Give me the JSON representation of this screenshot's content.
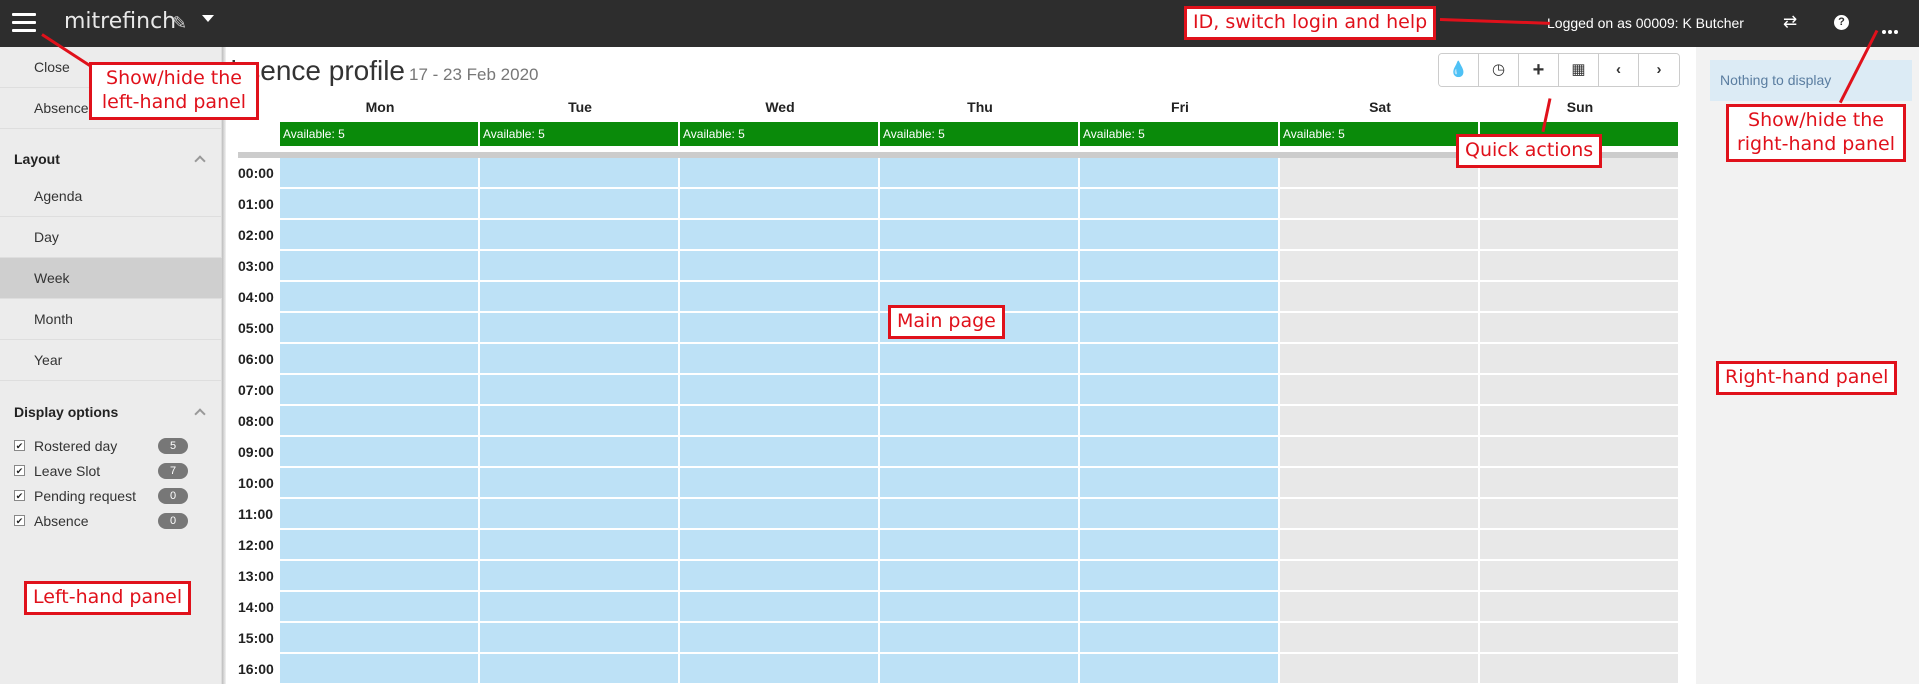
{
  "topbar": {
    "brand": "mitrefinch",
    "logged_on": "Logged on as 00009: K Butcher",
    "icons": [
      "menu-icon",
      "feather-icon",
      "chevron-down-icon",
      "switch-login-icon",
      "help-icon",
      "more-icon"
    ]
  },
  "left_panel": {
    "top_items": [
      {
        "label": "Close"
      },
      {
        "label": "Absence"
      }
    ],
    "layout": {
      "heading": "Layout",
      "items": [
        {
          "label": "Agenda",
          "active": false
        },
        {
          "label": "Day",
          "active": false
        },
        {
          "label": "Week",
          "active": true
        },
        {
          "label": "Month",
          "active": false
        },
        {
          "label": "Year",
          "active": false
        }
      ]
    },
    "display_options": {
      "heading": "Display options",
      "items": [
        {
          "label": "Rostered day",
          "checked": true,
          "count": "5"
        },
        {
          "label": "Leave Slot",
          "checked": true,
          "count": "7"
        },
        {
          "label": "Pending request",
          "checked": true,
          "count": "0"
        },
        {
          "label": "Absence",
          "checked": true,
          "count": "0"
        }
      ]
    }
  },
  "main": {
    "title": "Absence profile",
    "date_range": "17 - 23 Feb 2020",
    "quick_actions": [
      "drop-icon",
      "clock-icon",
      "plus-icon",
      "calendar-icon",
      "chevron-left-icon",
      "chevron-right-icon"
    ],
    "days": [
      {
        "name": "Mon",
        "available": "Available: 5",
        "type": "work"
      },
      {
        "name": "Tue",
        "available": "Available: 5",
        "type": "work"
      },
      {
        "name": "Wed",
        "available": "Available: 5",
        "type": "work"
      },
      {
        "name": "Thu",
        "available": "Available: 5",
        "type": "work"
      },
      {
        "name": "Fri",
        "available": "Available: 5",
        "type": "work"
      },
      {
        "name": "Sat",
        "available": "Available: 5",
        "type": "weekend"
      },
      {
        "name": "Sun",
        "available": "",
        "type": "weekend"
      }
    ],
    "hours": [
      "00:00",
      "01:00",
      "02:00",
      "03:00",
      "04:00",
      "05:00",
      "06:00",
      "07:00",
      "08:00",
      "09:00",
      "10:00",
      "11:00",
      "12:00",
      "13:00",
      "14:00",
      "15:00",
      "16:00"
    ],
    "colors": {
      "available": "#0a8a0a",
      "workday": "#bde1f6",
      "weekend": "#e8e8e8"
    }
  },
  "right_panel": {
    "empty_text": "Nothing to display"
  },
  "annotations": {
    "left_toggle": "Show/hide the left-hand panel",
    "id_help": "ID, switch login and help",
    "right_toggle": "Show/hide the right-hand panel",
    "quick_actions": "Quick actions",
    "main_page": "Main page",
    "right_panel": "Right-hand panel",
    "left_panel": "Left-hand panel"
  }
}
